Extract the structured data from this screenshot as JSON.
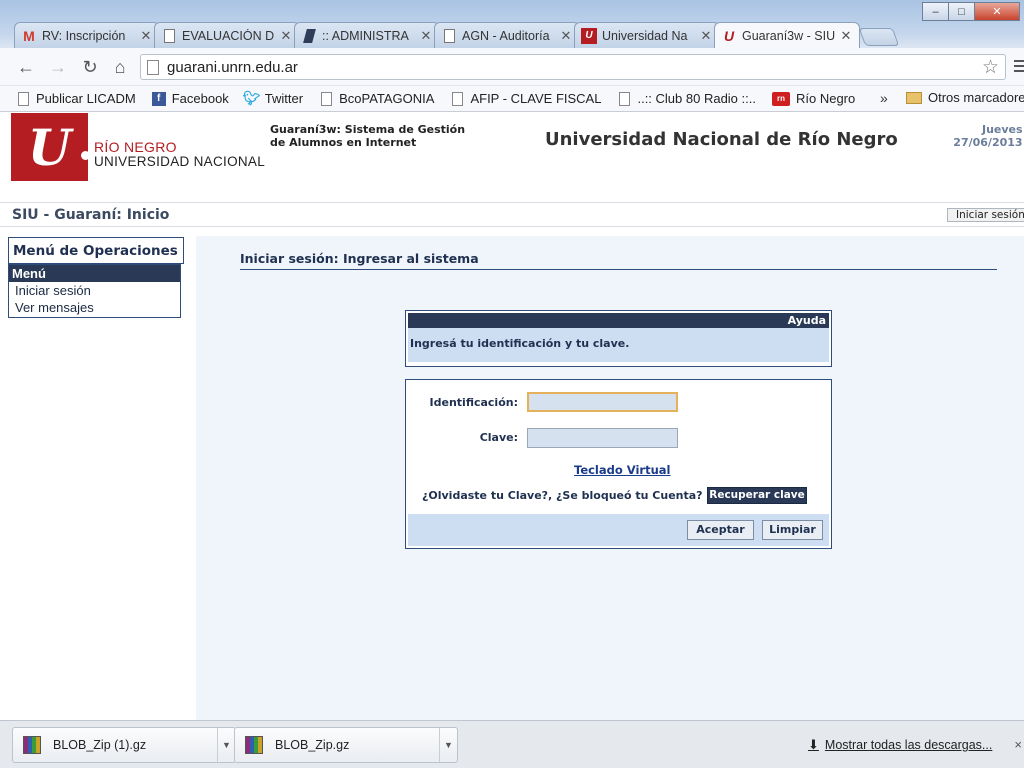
{
  "window": {
    "minimize": "–",
    "maximize": "□",
    "close": "✕"
  },
  "tabs": [
    {
      "label": "RV: Inscripción",
      "icon": "gmail-icon",
      "active": false
    },
    {
      "label": "EVALUACIÓN D",
      "icon": "page-icon",
      "active": false
    },
    {
      "label": ":: ADMINISTRA",
      "icon": "admin-icon",
      "active": false
    },
    {
      "label": "AGN - Auditoría",
      "icon": "page-icon",
      "active": false
    },
    {
      "label": "Universidad Na",
      "icon": "unrn-icon",
      "active": false
    },
    {
      "label": "Guaraní3w - SIU",
      "icon": "unrn-icon",
      "active": true
    }
  ],
  "toolbar": {
    "url": "guarani.unrn.edu.ar"
  },
  "bookmarks": {
    "items": [
      {
        "label": "Publicar LICADM",
        "icon": "page"
      },
      {
        "label": "Facebook",
        "icon": "facebook"
      },
      {
        "label": "Twitter",
        "icon": "twitter"
      },
      {
        "label": "BcoPATAGONIA",
        "icon": "page"
      },
      {
        "label": "AFIP - CLAVE FISCAL",
        "icon": "page"
      },
      {
        "label": "..:: Club 80 Radio ::..",
        "icon": "page"
      },
      {
        "label": "Río Negro",
        "icon": "rn"
      }
    ],
    "more": "»",
    "other": "Otros marcadores"
  },
  "header": {
    "logo_mark": "U",
    "logo_line1": "RÍO NEGRO",
    "logo_line2": "UNIVERSIDAD NACIONAL",
    "system_title": "Guaraní3w: Sistema de Gestión de Alumnos en Internet",
    "university": "Universidad Nacional de Río Negro",
    "date_day": "Jueves",
    "date_value": "27/06/2013"
  },
  "crumb": {
    "title": "SIU - Guaraní: Inicio",
    "login_button": "Iniciar sesión"
  },
  "sidebar": {
    "card_title": "Menú de Operaciones",
    "menu_head": "Menú",
    "links": [
      "Iniciar sesión",
      "Ver mensajes"
    ]
  },
  "content": {
    "section_title": "Iniciar sesión: Ingresar al sistema",
    "help": {
      "head": "Ayuda",
      "body": "Ingresá tu identificación y tu clave."
    },
    "form": {
      "id_label": "Identificación:",
      "id_value": "",
      "pass_label": "Clave:",
      "pass_value": "",
      "virtual_keyboard": "Teclado Virtual",
      "forgot": "¿Olvidaste tu Clave?, ¿Se bloqueó tu Cuenta?",
      "recover": "Recuperar clave",
      "accept": "Aceptar",
      "clear": "Limpiar"
    }
  },
  "downloads": {
    "items": [
      "BLOB_Zip (1).gz",
      "BLOB_Zip.gz"
    ],
    "show_all": "Mostrar todas las descargas...",
    "close": "×"
  }
}
